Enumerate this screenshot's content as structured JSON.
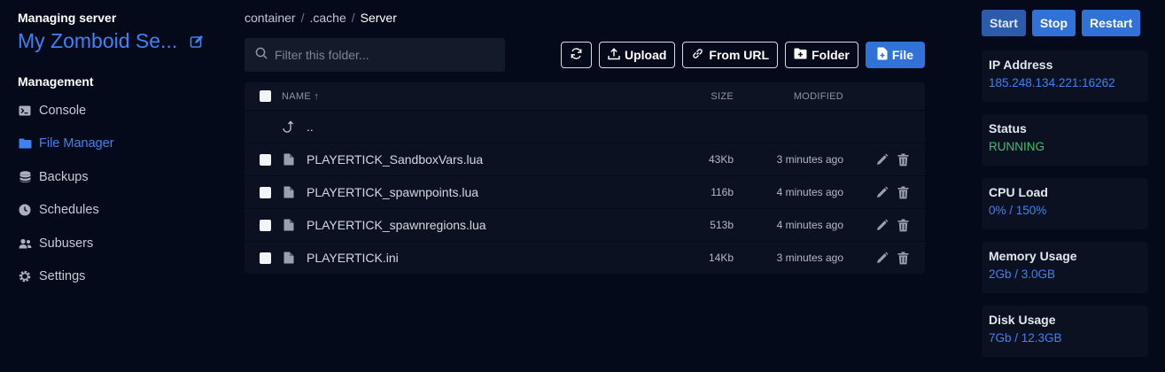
{
  "sidebar": {
    "managing_label": "Managing server",
    "server_name": "My Zomboid Se...",
    "section_label": "Management",
    "items": [
      {
        "label": "Console",
        "icon": "terminal-icon",
        "active": false
      },
      {
        "label": "File Manager",
        "icon": "folder-icon",
        "active": true
      },
      {
        "label": "Backups",
        "icon": "database-icon",
        "active": false
      },
      {
        "label": "Schedules",
        "icon": "clock-icon",
        "active": false
      },
      {
        "label": "Subusers",
        "icon": "users-icon",
        "active": false
      },
      {
        "label": "Settings",
        "icon": "gear-icon",
        "active": false
      }
    ]
  },
  "breadcrumb": {
    "parts": [
      "container",
      ".cache"
    ],
    "separator": "/",
    "current": "Server"
  },
  "filter": {
    "placeholder": "Filter this folder..."
  },
  "toolbar": {
    "upload_label": "Upload",
    "from_url_label": "From URL",
    "folder_label": "Folder",
    "file_label": "File"
  },
  "table": {
    "header": {
      "name": "NAME",
      "sort_indicator": "↑",
      "size": "SIZE",
      "modified": "MODIFIED"
    },
    "parent_dir": "..",
    "rows": [
      {
        "name": "PLAYERTICK_SandboxVars.lua",
        "size": "43Kb",
        "modified": "3 minutes ago"
      },
      {
        "name": "PLAYERTICK_spawnpoints.lua",
        "size": "116b",
        "modified": "4 minutes ago"
      },
      {
        "name": "PLAYERTICK_spawnregions.lua",
        "size": "513b",
        "modified": "4 minutes ago"
      },
      {
        "name": "PLAYERTICK.ini",
        "size": "14Kb",
        "modified": "3 minutes ago"
      }
    ]
  },
  "power": {
    "start": "Start",
    "stop": "Stop",
    "restart": "Restart"
  },
  "stats": [
    {
      "label": "IP Address",
      "value": "185.248.134.221:16262",
      "color": "#3f82f0"
    },
    {
      "label": "Status",
      "value": "RUNNING",
      "color": "#3fc06a"
    },
    {
      "label": "CPU Load",
      "value": "0% / 150%",
      "color": "#3f82f0"
    },
    {
      "label": "Memory Usage",
      "value": "2Gb / 3.0GB",
      "color": "#3f82f0"
    },
    {
      "label": "Disk Usage",
      "value": "7Gb / 12.3GB",
      "color": "#3f82f0"
    }
  ],
  "colors": {
    "accent": "#3f82f0",
    "background": "#050a1a",
    "panel": "#0b1120",
    "success": "#3fc06a"
  }
}
